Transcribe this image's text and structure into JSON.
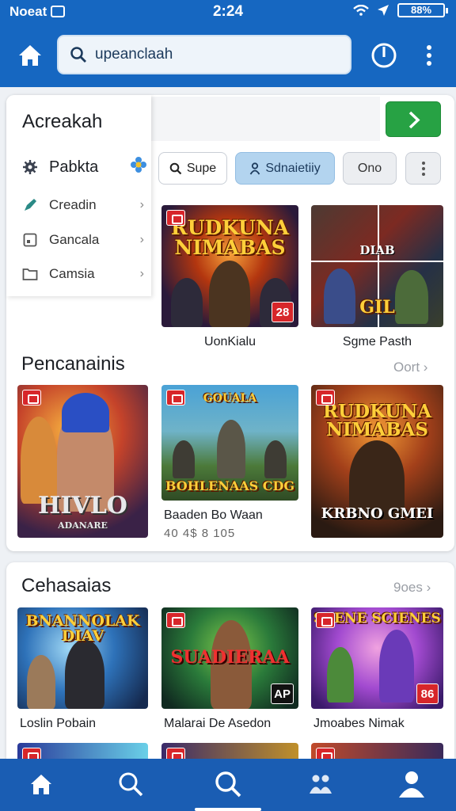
{
  "status_bar": {
    "carrier": "Noeat",
    "time": "2:24",
    "battery": "88%"
  },
  "header": {
    "search_value": "upeanclaah",
    "search_placeholder": ""
  },
  "sidebar": {
    "title": "Acreakah",
    "items": [
      {
        "label": "Pabkta",
        "icon": "gear-icon"
      },
      {
        "label": "Creadin",
        "icon": "pen-icon"
      },
      {
        "label": "Gancala",
        "icon": "square-icon"
      },
      {
        "label": "Camsia",
        "icon": "folder-icon"
      }
    ]
  },
  "chips": [
    {
      "label": "Supe",
      "icon": "search-icon"
    },
    {
      "label": "Sdnaietiiy",
      "icon": "person-icon"
    },
    {
      "label": "Ono"
    }
  ],
  "featured": [
    {
      "caption": "UonKialu",
      "art_title": "RUDKUNA NIMABAS",
      "rank": "28"
    },
    {
      "caption": "Sgme Pasth",
      "art_title": "DIAB",
      "art_sub": "GIL"
    }
  ],
  "section1": {
    "title": "Pencanainis",
    "more": "Oort",
    "items": [
      {
        "art_title": "HIVLO",
        "art_sub": "ADANARE"
      },
      {
        "caption": "Baaden Bo Waan",
        "sub": "40 4$ 8 105",
        "art_title": "GOUALA",
        "art_sub": "BOHLENAAS CDG"
      },
      {
        "art_title": "RUDKUNA NIMABAS",
        "art_sub": "KRBNO GMEI"
      }
    ]
  },
  "section2": {
    "title": "Cehasaias",
    "more": "9oes",
    "items": [
      {
        "caption": "Loslin Pobain",
        "art_title": "BNANNOLAK DIAV"
      },
      {
        "caption": "Malarai De Asedon",
        "art_title": "SUADIERAA",
        "rank": "AP"
      },
      {
        "caption": "Jmoabes Nimak",
        "art_title": "SCENE SCIENES",
        "rank": "86"
      }
    ]
  },
  "bottom_nav": [
    "home",
    "search",
    "discover",
    "community",
    "profile"
  ],
  "colors": {
    "header": "#1667c1",
    "accent_green": "#27a244",
    "badge_red": "#d7262a",
    "chip_active": "#b3d4ef"
  }
}
